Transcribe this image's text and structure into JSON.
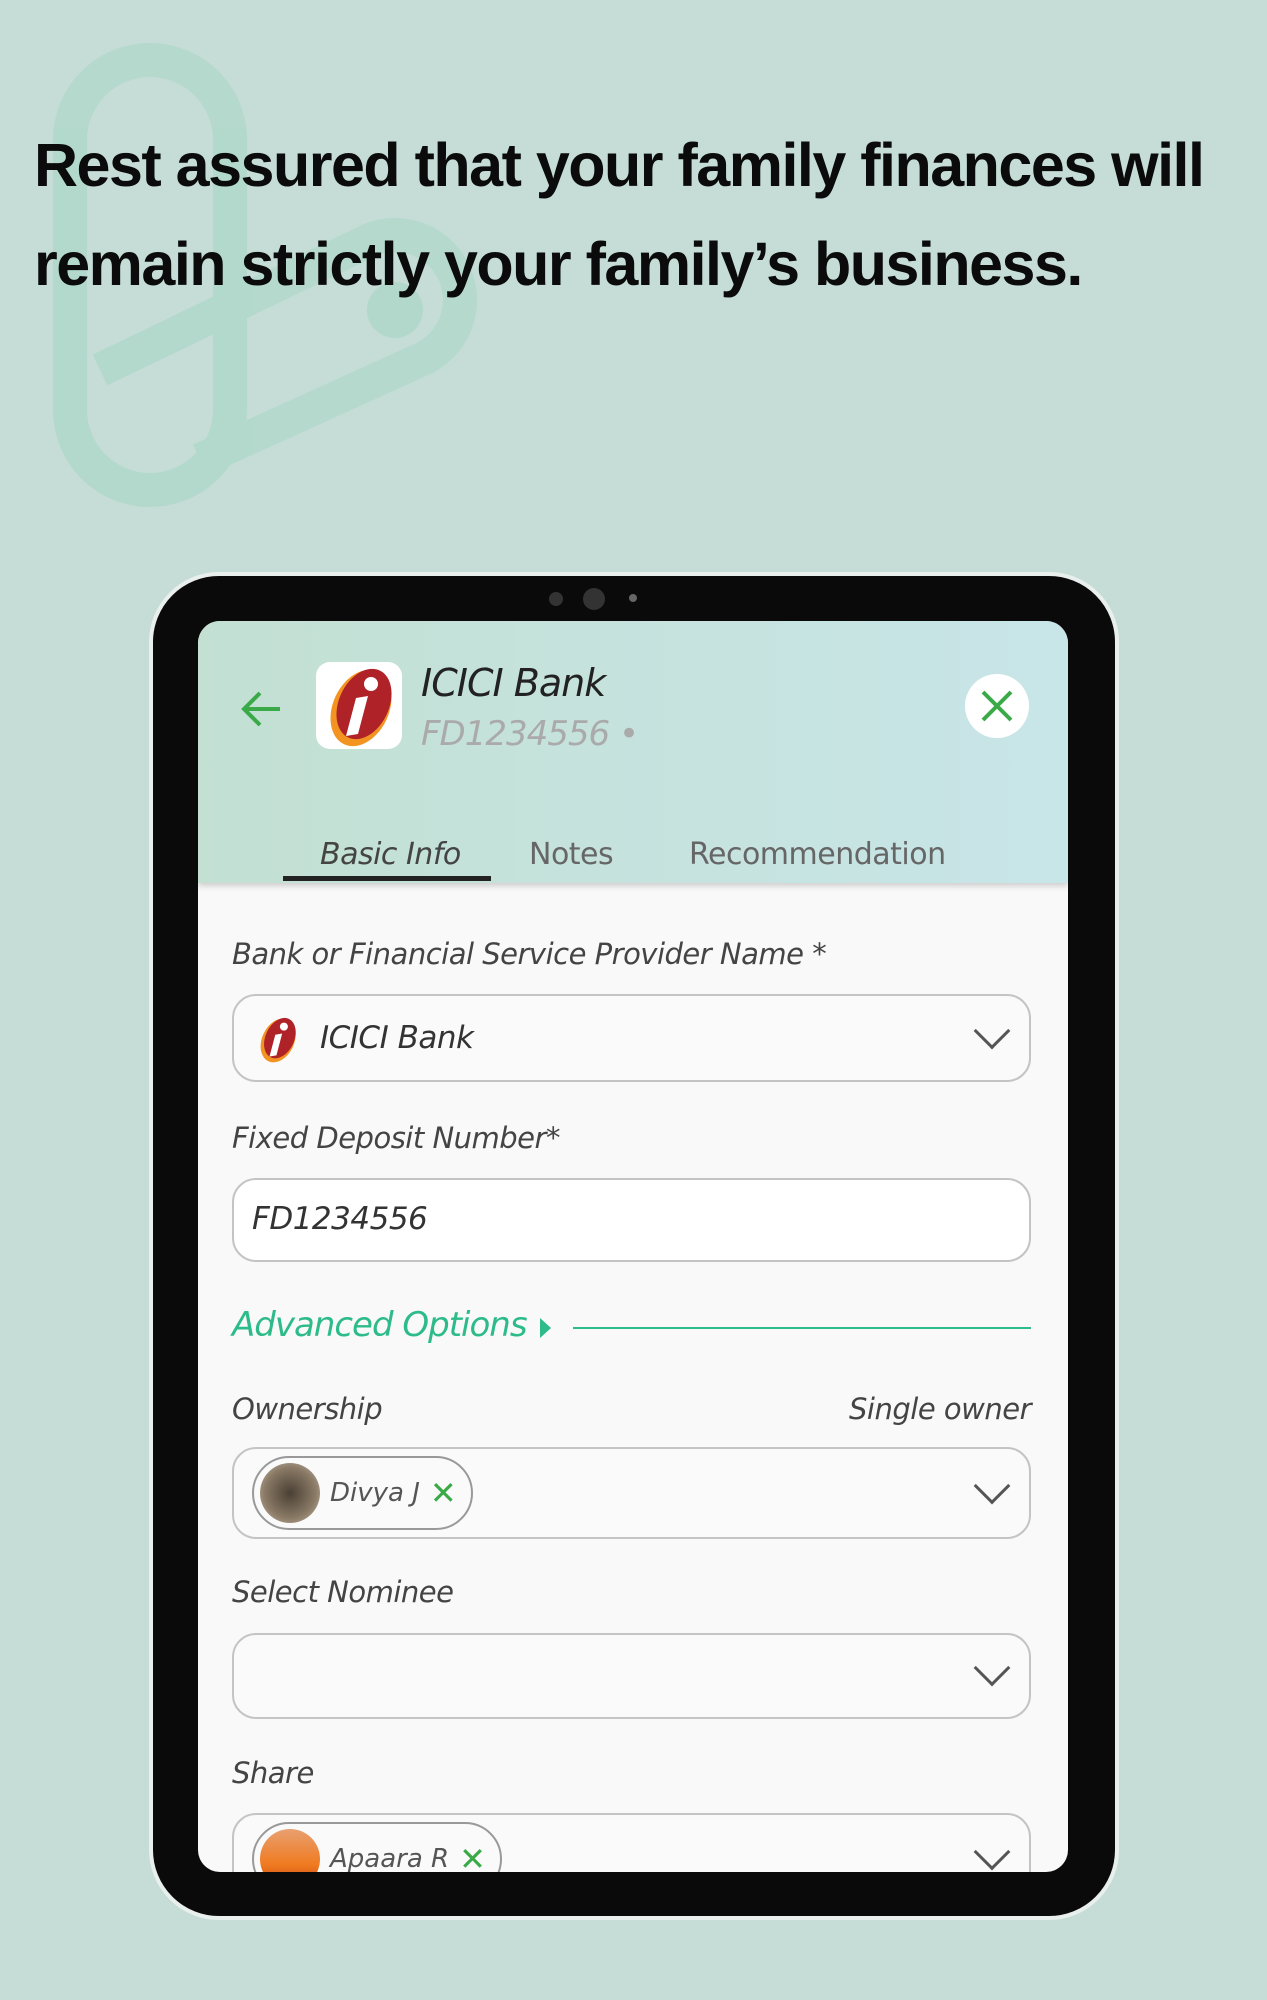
{
  "headline": {
    "line1": "Rest assured that your family finances will",
    "line2": "remain strictly your family’s business."
  },
  "header": {
    "back_icon": "arrow-left-icon",
    "logo": "ICICI i",
    "title": "ICICI Bank",
    "subtitle": "FD1234556 •",
    "close_icon": "close-x-icon"
  },
  "tabs": [
    {
      "label": "Basic Info",
      "active": true
    },
    {
      "label": "Notes"
    },
    {
      "label": "Recommendation"
    }
  ],
  "form": {
    "provider_label": "Bank or Financial Service Provider Name *",
    "provider_value": "ICICI Bank",
    "fd_label": "Fixed Deposit Number*",
    "fd_value": "FD1234556",
    "advanced_label": "Advanced Options",
    "ownership_label": "Ownership",
    "ownership_type": "Single owner",
    "owner_chip": "Divya J",
    "nominee_label": "Select Nominee",
    "nominee_value": "",
    "share_label": "Share",
    "share_chip": "Apaara R"
  },
  "colors": {
    "accent": "#3aaa48",
    "advanced": "#2dbb8a",
    "background": "#c5ddd6"
  }
}
